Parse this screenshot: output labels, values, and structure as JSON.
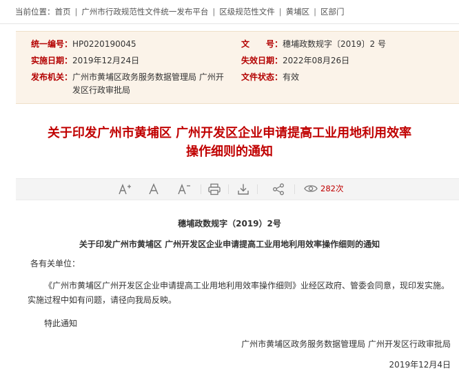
{
  "breadcrumb": {
    "prefix": "当前位置：",
    "items": [
      "首页",
      "广州市行政规范性文件统一发布平台",
      "区级规范性文件",
      "黄埔区",
      "区部门"
    ],
    "separator": "|"
  },
  "meta": {
    "unified_no_label": "统一编号：",
    "unified_no": "HP0220190045",
    "doc_no_label": "文　　号：",
    "doc_no": "穗埔政数规字〔2019〕2 号",
    "effective_date_label": "实施日期：",
    "effective_date": "2019年12月24日",
    "expiry_date_label": "失效日期：",
    "expiry_date": "2022年08月26日",
    "issuer_label": "发布机关：",
    "issuer": "广州市黄埔区政务服务数据管理局 广州开发区行政审批局",
    "status_label": "文件状态：",
    "status": "有效"
  },
  "title": {
    "line1": "关于印发广州市黄埔区 广州开发区企业申请提高工业用地利用效率",
    "line2": "操作细则的通知"
  },
  "toolbar": {
    "icons": [
      "font-increase-icon",
      "font-default-icon",
      "font-decrease-icon",
      "print-icon",
      "download-icon",
      "share-icon",
      "eye-icon"
    ],
    "views": "282次"
  },
  "body": {
    "doc_number": "穗埔政数规字（2019）2号",
    "doc_title": "关于印发广州市黄埔区 广州开发区企业申请提高工业用地利用效率操作细则的通知",
    "salutation": "各有关单位：",
    "paragraph1": "《广州市黄埔区广州开发区企业申请提高工业用地利用效率操作细则》业经区政府、管委会同意，现印发实施。实施过程中如有问题，请径向我局反映。",
    "closing": "特此通知",
    "signature": "广州市黄埔区政务服务数据管理局 广州开发区行政审批局",
    "date": "2019年12月4日"
  },
  "colors": {
    "accent_red": "#c00000",
    "meta_background": "#fbf3e9",
    "toolbar_background": "#f4f4f4"
  }
}
